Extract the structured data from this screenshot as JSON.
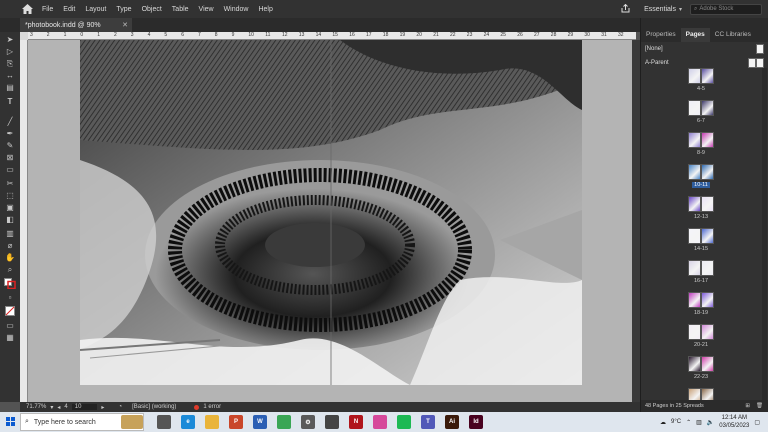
{
  "menubar": {
    "items": [
      "File",
      "Edit",
      "Layout",
      "Type",
      "Object",
      "Table",
      "View",
      "Window",
      "Help"
    ],
    "workspace": "Essentials",
    "search_placeholder": "Adobe Stock"
  },
  "document": {
    "tab_title": "*photobook.indd @ 90%"
  },
  "ruler": {
    "ticks": [
      "3",
      "2",
      "1",
      "0",
      "1",
      "2",
      "3",
      "4",
      "5",
      "6",
      "7",
      "8",
      "9",
      "10",
      "11",
      "12",
      "13",
      "14",
      "15",
      "16",
      "17",
      "18",
      "19",
      "20",
      "21",
      "22",
      "23",
      "24",
      "25",
      "26",
      "27",
      "28",
      "29",
      "30",
      "31",
      "32"
    ]
  },
  "status": {
    "zoom": "71.77%",
    "page": "4",
    "page_field": "10",
    "preflight_profile": "[Basic] (working)",
    "errors": "1 error"
  },
  "panel": {
    "tabs": [
      "Properties",
      "Pages",
      "CC Libraries"
    ],
    "active_tab": "Pages",
    "masters": [
      {
        "label": "[None]"
      },
      {
        "label": "A-Parent"
      }
    ],
    "spreads": [
      {
        "label": "4-5",
        "selected": false,
        "colors": [
          "#cfcfe8",
          "#5a4fa0"
        ]
      },
      {
        "label": "6-7",
        "selected": false,
        "colors": [
          "#efeff6",
          "#3e3a6a"
        ]
      },
      {
        "label": "8-9",
        "selected": false,
        "colors": [
          "#8f7fd0",
          "#c43ab0"
        ]
      },
      {
        "label": "10-11",
        "selected": true,
        "colors": [
          "#4a86c8",
          "#2f6ab0"
        ]
      },
      {
        "label": "12-13",
        "selected": false,
        "colors": [
          "#6a48c8",
          "#e9e2f6"
        ]
      },
      {
        "label": "14-15",
        "selected": false,
        "colors": [
          "#f4f4fa",
          "#4f6ad0"
        ]
      },
      {
        "label": "16-17",
        "selected": false,
        "colors": [
          "#d8d4e6",
          "#ecebf3"
        ]
      },
      {
        "label": "18-19",
        "selected": false,
        "colors": [
          "#c03cc0",
          "#7d5ad8"
        ]
      },
      {
        "label": "20-21",
        "selected": false,
        "colors": [
          "#f3eef6",
          "#d28ad8"
        ]
      },
      {
        "label": "22-23",
        "selected": false,
        "colors": [
          "#2a1a30",
          "#d03ca8"
        ]
      },
      {
        "label": "",
        "selected": false,
        "colors": [
          "#c9a27a",
          "#8a6a4c"
        ]
      }
    ],
    "footer": "48 Pages in 25 Spreads"
  },
  "taskbar": {
    "search_placeholder": "Type here to search",
    "apps": [
      {
        "name": "task-view",
        "color": "#555",
        "glyph": ""
      },
      {
        "name": "edge",
        "color": "#1b8ad8",
        "glyph": "e"
      },
      {
        "name": "file-explorer",
        "color": "#e9b43a",
        "glyph": ""
      },
      {
        "name": "powerpoint",
        "color": "#c9462a",
        "glyph": "P"
      },
      {
        "name": "word",
        "color": "#2b5fb4",
        "glyph": "W"
      },
      {
        "name": "chrome",
        "color": "#3aa655",
        "glyph": ""
      },
      {
        "name": "settings",
        "color": "#5a5a5a",
        "glyph": "⚙"
      },
      {
        "name": "camera",
        "color": "#444",
        "glyph": ""
      },
      {
        "name": "netflix",
        "color": "#b0151c",
        "glyph": "N"
      },
      {
        "name": "instagram",
        "color": "#d6489a",
        "glyph": ""
      },
      {
        "name": "spotify",
        "color": "#1db954",
        "glyph": ""
      },
      {
        "name": "teams",
        "color": "#5058b8",
        "glyph": "T"
      },
      {
        "name": "illustrator",
        "color": "#3a1a0a",
        "glyph": "Ai"
      },
      {
        "name": "indesign",
        "color": "#49021f",
        "glyph": "Id"
      }
    ],
    "weather": "9°C",
    "time": "12:14 AM",
    "date": "03/05/2023"
  }
}
